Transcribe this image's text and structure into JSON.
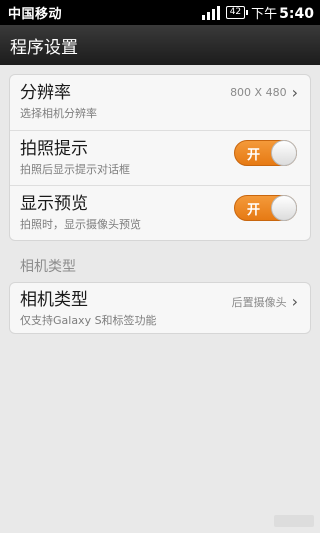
{
  "status_bar": {
    "carrier": "中国移动",
    "battery": "42",
    "ampm": "下午",
    "time": "5:40"
  },
  "header": {
    "title": "程序设置"
  },
  "settings": [
    {
      "title": "分辨率",
      "summary": "选择相机分辨率",
      "value": "800 X 480"
    },
    {
      "title": "拍照提示",
      "summary": "拍照后显示提示对话框",
      "toggle_label": "开",
      "enabled": true
    },
    {
      "title": "显示预览",
      "summary": "拍照时，显示摄像头预览",
      "toggle_label": "开",
      "enabled": true
    }
  ],
  "camera_section": {
    "header": "相机类型",
    "item": {
      "title": "相机类型",
      "summary": "仅支持Galaxy S和标签功能",
      "value": "后置摄像头"
    }
  },
  "colors": {
    "toggle_on": "#e67a14",
    "status_bar": "#000000",
    "title_bar": "#2a2a2a",
    "background": "#e9e9e9"
  }
}
